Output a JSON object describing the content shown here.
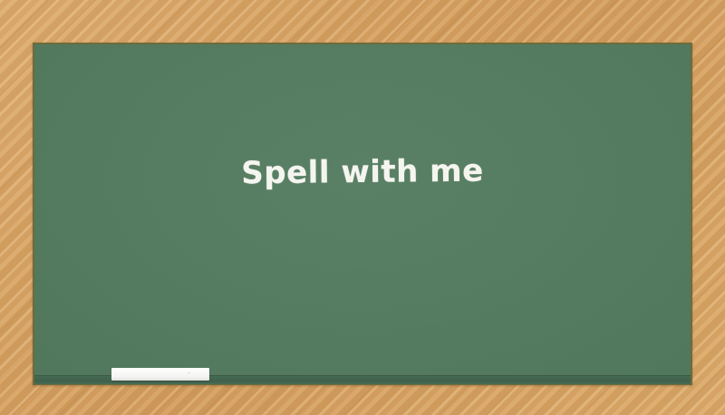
{
  "game": {
    "title": "Spell with me"
  },
  "colors": {
    "board": "#547c60",
    "board_border": "#6f6b3b",
    "wood": "#d9a86a",
    "chalk": "#ffffff",
    "text": "#f5f5ef"
  }
}
